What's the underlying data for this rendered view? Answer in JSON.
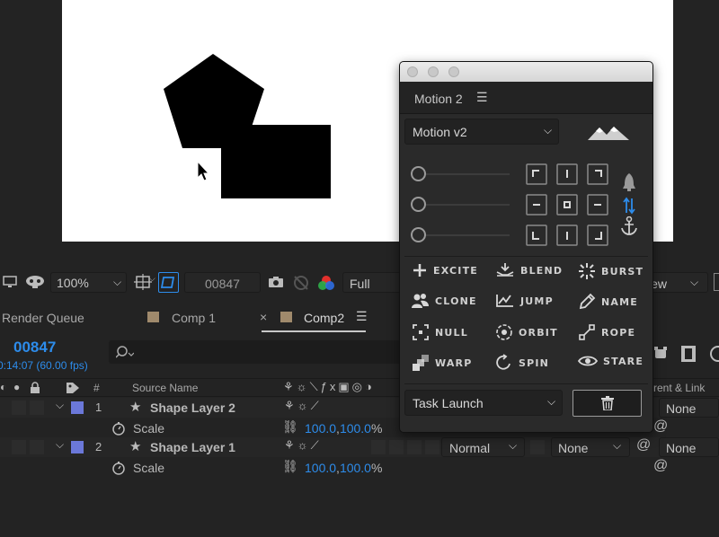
{
  "viewer": {
    "zoom": "100%",
    "timecode": "00847",
    "resolution": "Full",
    "view": "iew"
  },
  "tabs": [
    {
      "label": "Render Queue"
    },
    {
      "label": "Comp 1"
    },
    {
      "label": "Comp2"
    }
  ],
  "timeline": {
    "timecode": "00847",
    "time_detail": "0:14:07 (60.00 fps)",
    "search_placeholder": "",
    "columns": {
      "number": "#",
      "source_name": "Source Name",
      "parent_link": "rent & Link"
    },
    "layers": [
      {
        "number": "1",
        "name": "Shape Layer 2",
        "color": "#6b78d9",
        "mode": "",
        "trkmat": "",
        "parent": "None",
        "property": "Scale",
        "scale_x": "100.0",
        "scale_y": "100.0",
        "unit": "%"
      },
      {
        "number": "2",
        "name": "Shape Layer 1",
        "color": "#6b78d9",
        "mode": "Normal",
        "trkmat": "None",
        "parent": "None",
        "property": "Scale",
        "scale_x": "100.0",
        "scale_y": "100.0",
        "unit": "%"
      }
    ]
  },
  "motion_panel": {
    "title": "Motion 2",
    "preset": "Motion v2",
    "task": "Task Launch",
    "sliders": [
      0,
      0,
      0
    ],
    "buttons": [
      {
        "label": "EXCITE",
        "icon": "plus-icon"
      },
      {
        "label": "BLEND",
        "icon": "blend-icon"
      },
      {
        "label": "BURST",
        "icon": "burst-icon"
      },
      {
        "label": "CLONE",
        "icon": "clone-icon"
      },
      {
        "label": "JUMP",
        "icon": "jump-icon"
      },
      {
        "label": "NAME",
        "icon": "pencil-icon"
      },
      {
        "label": "NULL",
        "icon": "null-icon"
      },
      {
        "label": "ORBIT",
        "icon": "orbit-icon"
      },
      {
        "label": "ROPE",
        "icon": "rope-icon"
      },
      {
        "label": "WARP",
        "icon": "warp-icon"
      },
      {
        "label": "SPIN",
        "icon": "spin-icon"
      },
      {
        "label": "STARE",
        "icon": "eye-icon"
      }
    ]
  },
  "colors": {
    "accent_blue": "#2d8ceb",
    "layer_label": "#6b78d9",
    "tab_comp1_label": "#a08a6c"
  }
}
